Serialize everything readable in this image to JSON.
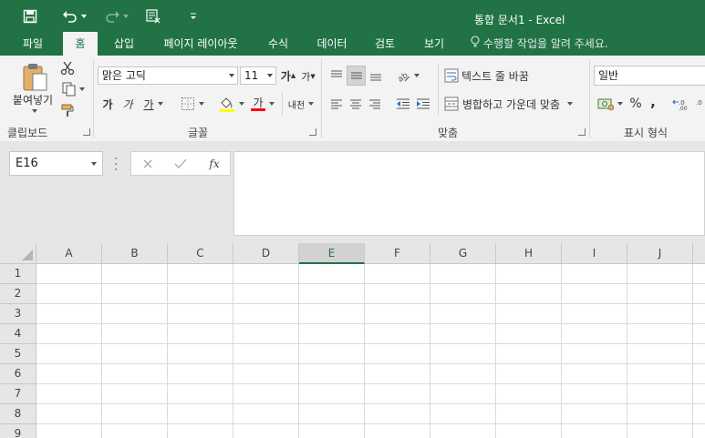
{
  "app": {
    "doc_title": "통합 문서1 - Excel",
    "accent": "#217346"
  },
  "qat": {
    "icons": [
      "save-icon",
      "undo-icon",
      "redo-icon",
      "form-icon",
      "customize-icon"
    ]
  },
  "tabs": [
    "파일",
    "홈",
    "삽입",
    "페이지 레이아웃",
    "수식",
    "데이터",
    "검토",
    "보기"
  ],
  "tell_me": "수행할 작업을 알려 주세요.",
  "clipboard": {
    "paste_label": "붙여넣기",
    "group_label": "클립보드"
  },
  "font": {
    "name": "맑은 고딕",
    "size": "11",
    "grow_label": "가",
    "shrink_label": "가",
    "bold_label": "가",
    "italic_label": "가",
    "underline_label": "가",
    "color_label": "가",
    "phonetic_label": "내천",
    "group_label": "글꼴"
  },
  "alignment": {
    "wrap_label": "텍스트 줄 바꿈",
    "merge_label": "병합하고 가운데 맞춤",
    "group_label": "맞춤"
  },
  "number": {
    "format": "일반",
    "percent": "%",
    "comma": ",",
    "group_label": "표시 형식"
  },
  "formula_bar": {
    "name_box": "E16",
    "fx_label": "fx",
    "content": ""
  },
  "sheet": {
    "columns": [
      "A",
      "B",
      "C",
      "D",
      "E",
      "F",
      "G",
      "H",
      "I",
      "J"
    ],
    "selected_column": "E",
    "rows": [
      "1",
      "2",
      "3",
      "4",
      "5",
      "6",
      "7",
      "8",
      "9"
    ]
  }
}
